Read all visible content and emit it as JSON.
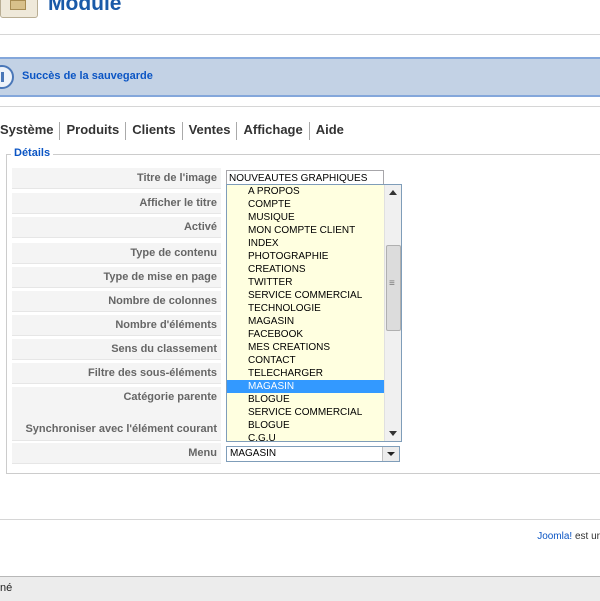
{
  "header": {
    "title": "Module"
  },
  "message": {
    "text": "Succès de la sauvegarde"
  },
  "tabs": [
    "Système",
    "Produits",
    "Clients",
    "Ventes",
    "Affichage",
    "Aide"
  ],
  "details": {
    "legend": "Détails",
    "labels": {
      "titre": "Titre de l'image",
      "afficher_titre": "Afficher le titre",
      "active": "Activé",
      "type_contenu": "Type de contenu",
      "type_mise_en_page": "Type de mise en page",
      "nombre_colonnes": "Nombre de colonnes",
      "nombre_elements": "Nombre d'éléments",
      "sens_classement": "Sens du classement",
      "filtre": "Filtre des sous-éléments",
      "categorie": "Catégorie parente",
      "synchroniser": "Synchroniser avec l'élément courant",
      "menu": "Menu"
    },
    "title_value": "NOUVEAUTES GRAPHIQUES",
    "menu_value": "MAGASIN"
  },
  "dropdown": {
    "options": [
      "A PROPOS",
      "COMPTE",
      "MUSIQUE",
      "MON COMPTE CLIENT",
      "INDEX",
      "PHOTOGRAPHIE",
      "CREATIONS",
      "TWITTER",
      "SERVICE COMMERCIAL",
      "TECHNOLOGIE",
      "MAGASIN",
      "FACEBOOK",
      "MES CREATIONS",
      "CONTACT",
      "TELECHARGER",
      "MAGASIN",
      "BLOGUE",
      "SERVICE COMMERCIAL",
      "BLOGUE",
      "C.G.U"
    ],
    "selected_index": 15,
    "highlight_color": "#3399ff"
  },
  "footer": {
    "link": "Joomla!",
    "text": " est ur"
  },
  "statusbar": {
    "text": "né"
  }
}
